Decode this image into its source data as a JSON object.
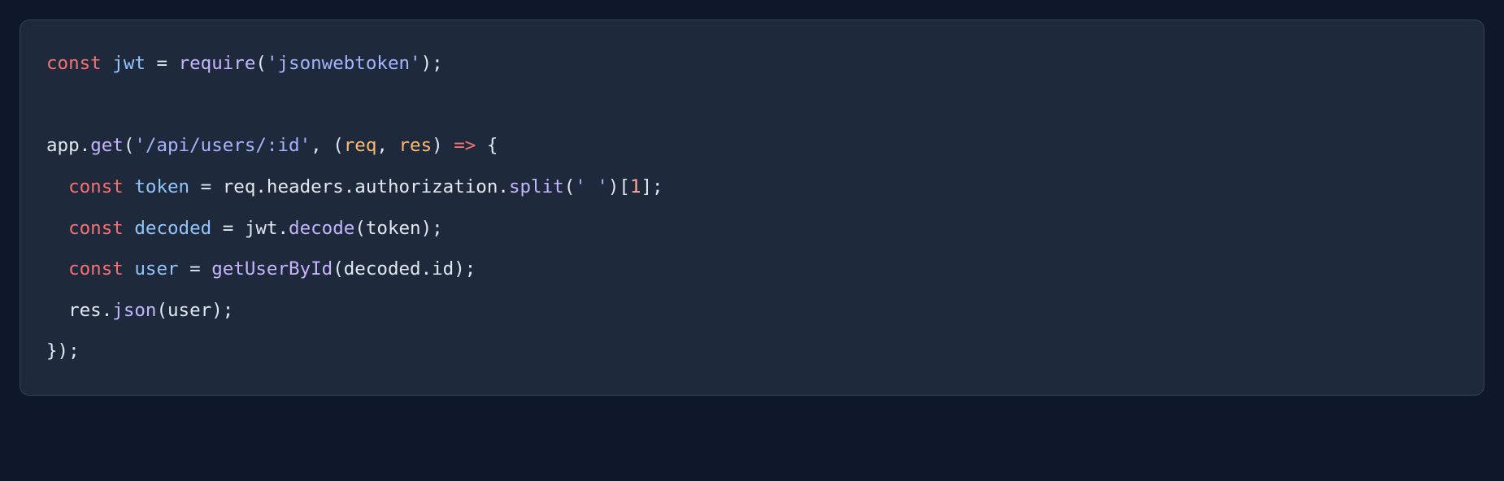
{
  "code": {
    "language": "javascript",
    "lines": [
      {
        "indent": 0,
        "tokens": [
          {
            "t": "const ",
            "c": "tk-kw"
          },
          {
            "t": "jwt",
            "c": "tk-var"
          },
          {
            "t": " = ",
            "c": "tk-p"
          },
          {
            "t": "require",
            "c": "tk-fn"
          },
          {
            "t": "(",
            "c": "tk-p"
          },
          {
            "t": "'jsonwebtoken'",
            "c": "tk-str"
          },
          {
            "t": ");",
            "c": "tk-p"
          }
        ]
      },
      {
        "blank": true
      },
      {
        "indent": 0,
        "tokens": [
          {
            "t": "app.",
            "c": "tk-id"
          },
          {
            "t": "get",
            "c": "tk-fn"
          },
          {
            "t": "(",
            "c": "tk-p"
          },
          {
            "t": "'/api/users/:id'",
            "c": "tk-str"
          },
          {
            "t": ", (",
            "c": "tk-p"
          },
          {
            "t": "req",
            "c": "tk-param"
          },
          {
            "t": ", ",
            "c": "tk-p"
          },
          {
            "t": "res",
            "c": "tk-param"
          },
          {
            "t": ") ",
            "c": "tk-p"
          },
          {
            "t": "=>",
            "c": "tk-op"
          },
          {
            "t": " {",
            "c": "tk-p"
          }
        ]
      },
      {
        "indent": 1,
        "tokens": [
          {
            "t": "const ",
            "c": "tk-kw"
          },
          {
            "t": "token",
            "c": "tk-var"
          },
          {
            "t": " = req.headers.authorization.",
            "c": "tk-id"
          },
          {
            "t": "split",
            "c": "tk-fn"
          },
          {
            "t": "(",
            "c": "tk-p"
          },
          {
            "t": "' '",
            "c": "tk-str"
          },
          {
            "t": ")[",
            "c": "tk-p"
          },
          {
            "t": "1",
            "c": "tk-num"
          },
          {
            "t": "];",
            "c": "tk-p"
          }
        ]
      },
      {
        "indent": 1,
        "tokens": [
          {
            "t": "const ",
            "c": "tk-kw"
          },
          {
            "t": "decoded",
            "c": "tk-var"
          },
          {
            "t": " = jwt.",
            "c": "tk-id"
          },
          {
            "t": "decode",
            "c": "tk-fn"
          },
          {
            "t": "(token);",
            "c": "tk-p"
          }
        ]
      },
      {
        "indent": 1,
        "tokens": [
          {
            "t": "const ",
            "c": "tk-kw"
          },
          {
            "t": "user",
            "c": "tk-var"
          },
          {
            "t": " = ",
            "c": "tk-p"
          },
          {
            "t": "getUserById",
            "c": "tk-fn"
          },
          {
            "t": "(decoded.id);",
            "c": "tk-p"
          }
        ]
      },
      {
        "indent": 1,
        "tokens": [
          {
            "t": "res.",
            "c": "tk-id"
          },
          {
            "t": "json",
            "c": "tk-fn"
          },
          {
            "t": "(user);",
            "c": "tk-p"
          }
        ]
      },
      {
        "indent": 0,
        "tokens": [
          {
            "t": "});",
            "c": "tk-p"
          }
        ]
      }
    ]
  },
  "indent_unit": "  ",
  "colors": {
    "page_bg": "#0f172a",
    "block_bg": "#1e293b",
    "block_border": "#334155",
    "keyword": "#f87171",
    "variable": "#93c5fd",
    "function": "#c4b5fd",
    "string": "#a5b4fc",
    "number": "#fca5a5",
    "operator": "#f87171",
    "param": "#fdba74",
    "default": "#e2e8f0"
  }
}
